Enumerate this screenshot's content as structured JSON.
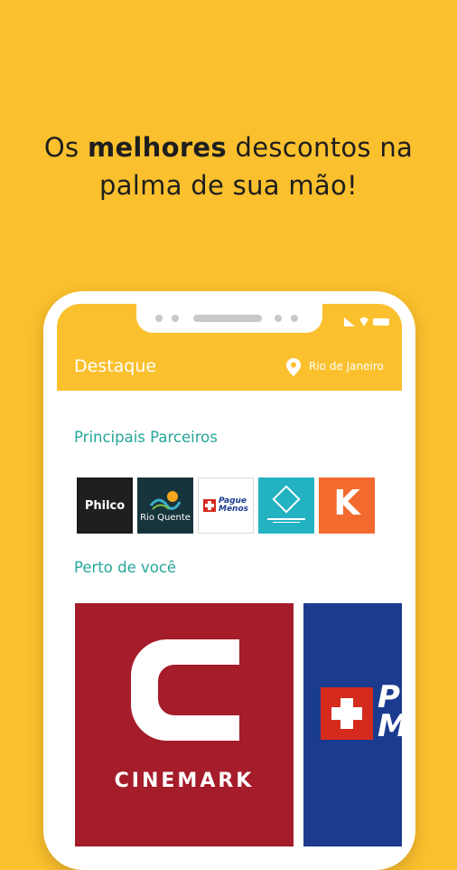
{
  "headline": {
    "prefix": "Os ",
    "bold": "melhores",
    "rest_line1": " descontos na",
    "line2": "palma de sua mão!"
  },
  "app": {
    "title": "Destaque",
    "location": "Rio de Janeiro"
  },
  "sections": {
    "partners_title": "Principais Parceiros",
    "nearby_title": "Perto de você"
  },
  "partners": [
    {
      "name": "Philco",
      "text": "Philco"
    },
    {
      "name": "Rio Quente",
      "text": "Rio Quente"
    },
    {
      "name": "Pague Menos",
      "text_line1": "Pague",
      "text_line2": "Menos"
    },
    {
      "name": "teal-partner"
    },
    {
      "name": "orange-partner",
      "text": "K"
    }
  ],
  "nearby": [
    {
      "name": "Cinemark",
      "text": "CINEMARK",
      "color": "#A51C2A"
    },
    {
      "name": "Pague Menos",
      "text": "P\nM",
      "color": "#1B3B8F"
    }
  ],
  "colors": {
    "background": "#FBC02D",
    "accent": "#26A69A"
  }
}
